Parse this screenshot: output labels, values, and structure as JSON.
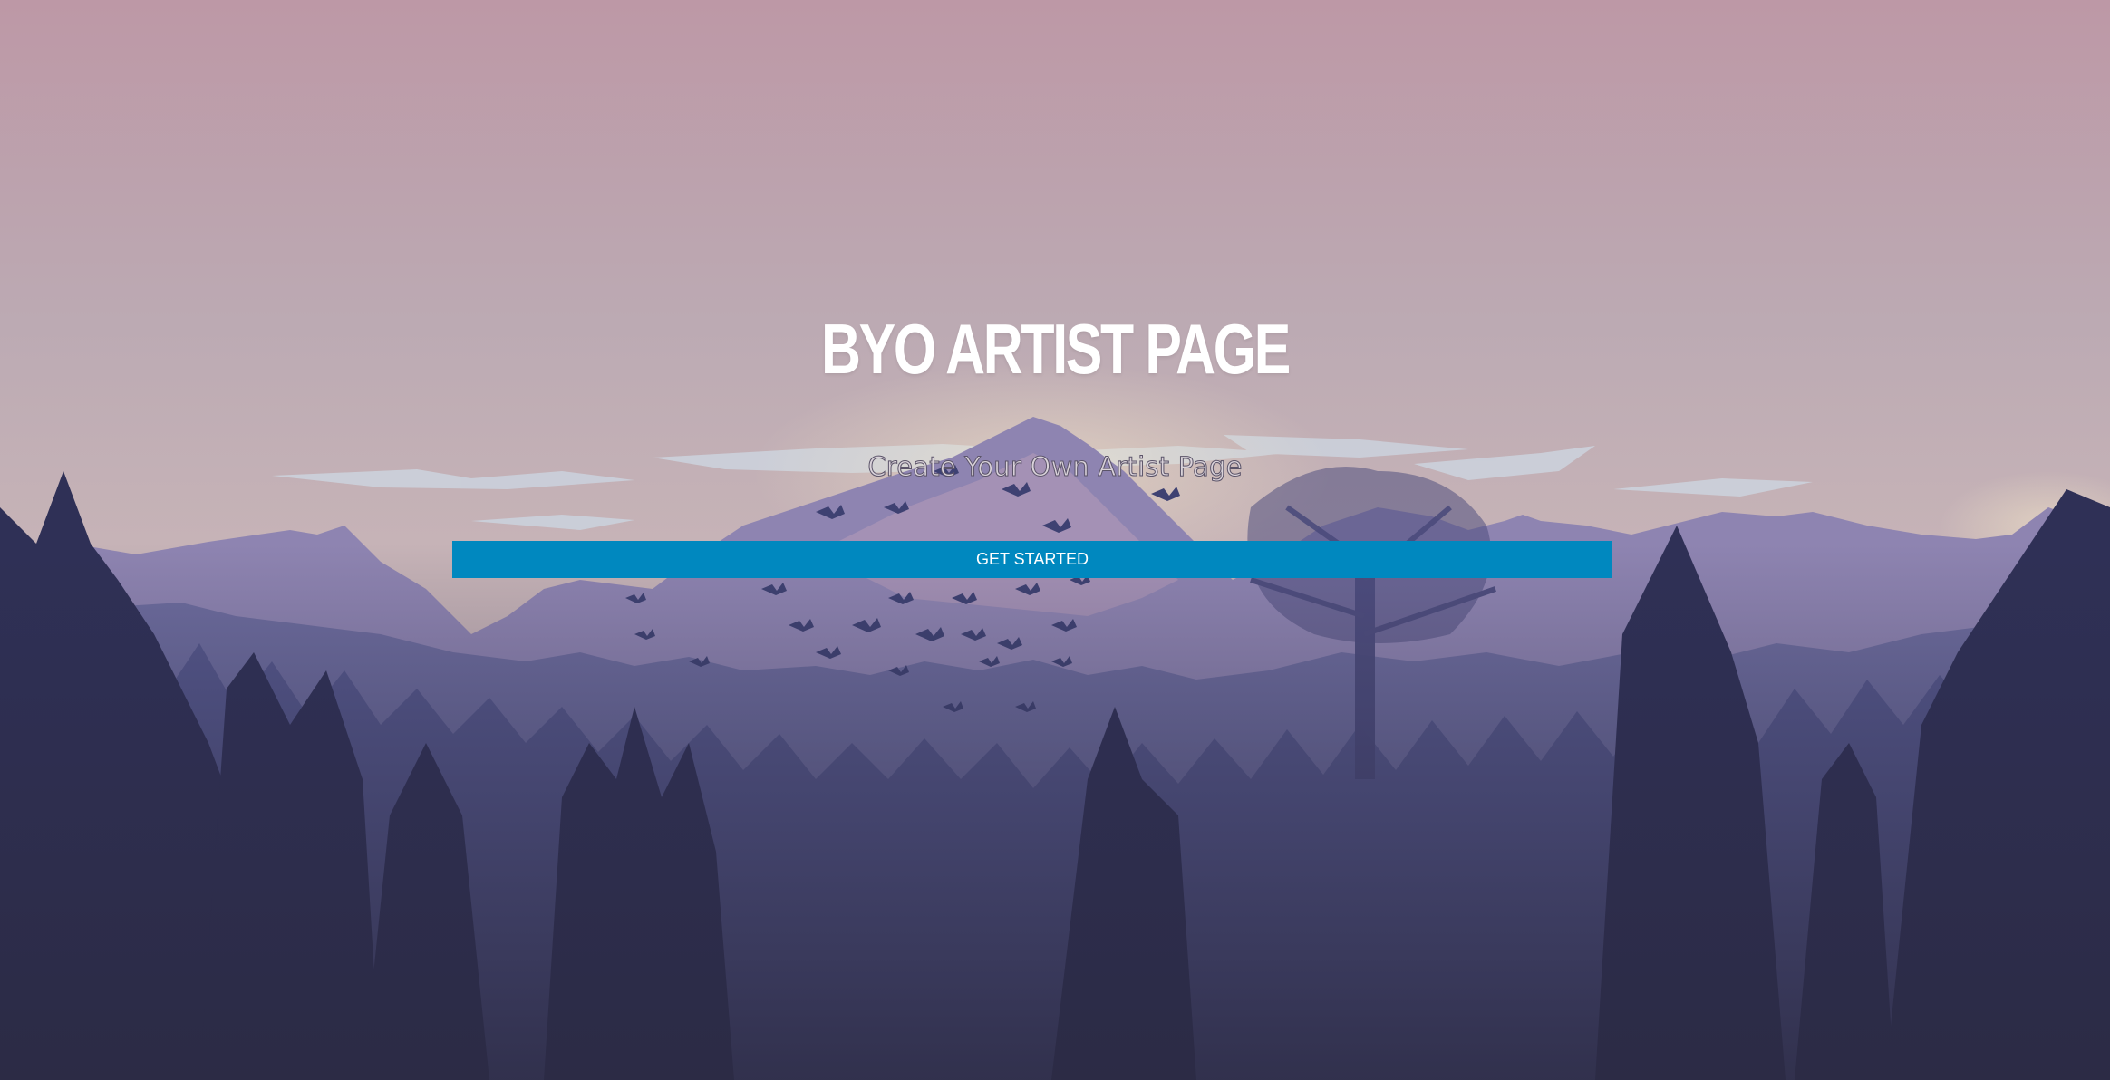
{
  "hero": {
    "title": "BYO ARTIST PAGE",
    "subtitle": "Create Your Own Artist Page",
    "cta_label": "GET STARTED"
  },
  "colors": {
    "sky_top": "#bc98a6",
    "sky_horizon": "#c5b0b6",
    "mountain_far": "#8c82ae",
    "forest_mid": "#4d5183",
    "forest_dark": "#2f2d47",
    "button": "#0088bf",
    "button_text": "#ffffff",
    "title_text": "#ffffff"
  },
  "background": {
    "description_icon": "mountain-forest-landscape"
  }
}
